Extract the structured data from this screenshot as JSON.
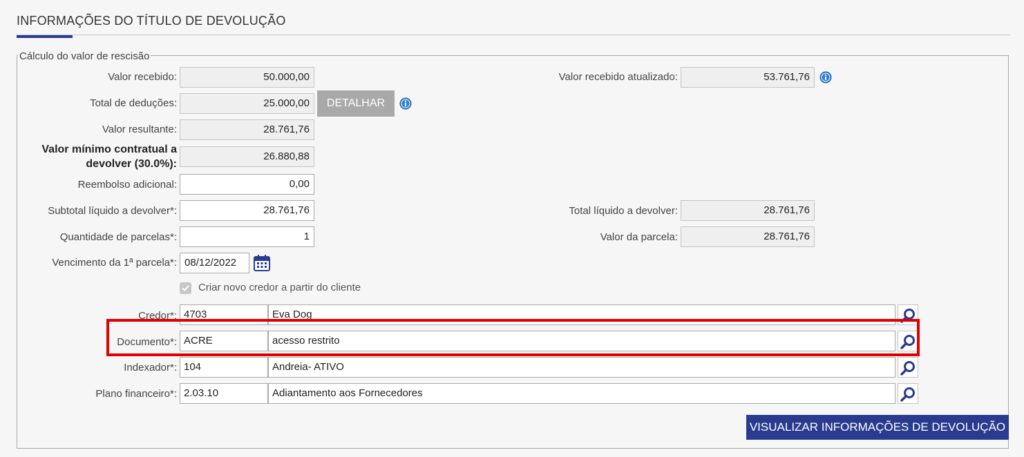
{
  "section": {
    "title": "INFORMAÇÕES DO TÍTULO DE DEVOLUÇÃO"
  },
  "fieldset": {
    "legend": "Cálculo do valor de rescisão"
  },
  "fields": {
    "valor_recebido": {
      "label": "Valor recebido:",
      "value": "50.000,00"
    },
    "total_deducoes": {
      "label": "Total de deduções:",
      "value": "25.000,00"
    },
    "detalhar_button": "DETALHAR",
    "valor_resultante": {
      "label": "Valor resultante:",
      "value": "28.761,76"
    },
    "valor_minimo": {
      "label": "Valor mínimo contratual a devolver (30.0%):",
      "value": "26.880,88"
    },
    "reembolso": {
      "label": "Reembolso adicional:",
      "value": "0,00"
    },
    "subtotal": {
      "label": "Subtotal líquido a devolver*:",
      "value": "28.761,76"
    },
    "quantidade": {
      "label": "Quantidade de parcelas*:",
      "value": "1"
    },
    "vencimento": {
      "label": "Vencimento da 1ª parcela*:",
      "value": "08/12/2022"
    },
    "valor_recebido_atualizado": {
      "label": "Valor recebido atualizado:",
      "value": "53.761,76"
    },
    "total_liquido": {
      "label": "Total líquido a devolver:",
      "value": "28.761,76"
    },
    "valor_parcela": {
      "label": "Valor da parcela:",
      "value": "28.761,76"
    }
  },
  "checkbox": {
    "label": "Criar novo credor a partir do cliente",
    "checked": true
  },
  "lookups": {
    "credor": {
      "label": "Credor*:",
      "code": "4703",
      "description": "Eva Dog"
    },
    "documento": {
      "label": "Documento*:",
      "code": "ACRE",
      "description": "acesso restrito"
    },
    "indexador": {
      "label": "Indexador*:",
      "code": "104",
      "description": "Andreia- ATIVO"
    },
    "plano": {
      "label": "Plano financeiro*:",
      "code": "2.03.10",
      "description": "Adiantamento aos Fornecedores"
    }
  },
  "actions": {
    "visualizar": "VISUALIZAR INFORMAÇÕES DE DEVOLUÇÃO"
  },
  "icons": {
    "info": "info-icon",
    "calendar": "calendar-icon",
    "search": "search-icon",
    "check": "check-icon"
  },
  "colors": {
    "primary": "#2a3b8f",
    "highlight": "#e00000",
    "disabled_button": "#a9a9a9",
    "info": "#2f7fd1"
  }
}
